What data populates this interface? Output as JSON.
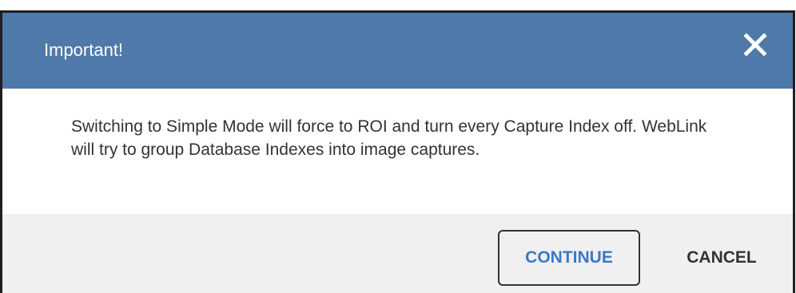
{
  "dialog": {
    "title": "Important!",
    "close_icon": "close-icon",
    "message": "Switching to Simple Mode will force to ROI and turn every Capture Index off. WebLink will try to group Database Indexes into image captures.",
    "continue_label": "CONTINUE",
    "cancel_label": "CANCEL"
  },
  "colors": {
    "header_bg": "#4f79a9",
    "continue_text": "#3b78c2",
    "footer_bg": "#f0f0f0"
  }
}
